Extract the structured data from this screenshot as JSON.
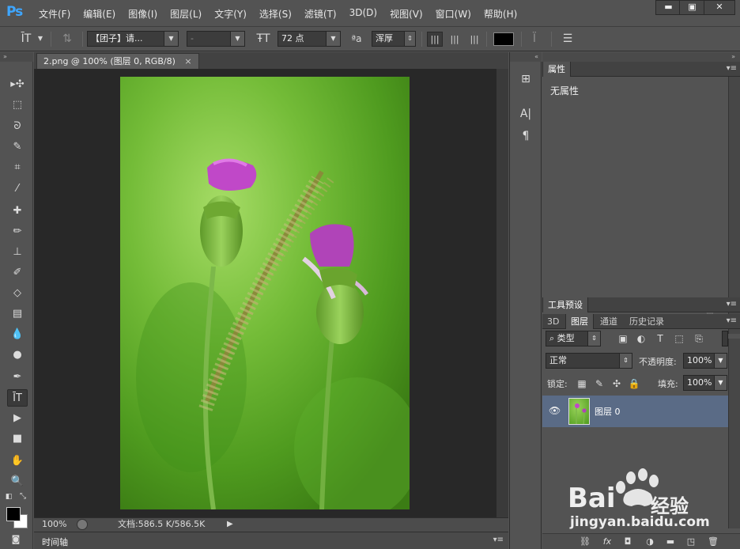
{
  "app": {
    "logo": "Ps"
  },
  "menu": [
    "文件(F)",
    "编辑(E)",
    "图像(I)",
    "图层(L)",
    "文字(Y)",
    "选择(S)",
    "滤镜(T)",
    "3D(D)",
    "视图(V)",
    "窗口(W)",
    "帮助(H)"
  ],
  "window_controls": {
    "minimize": "▬",
    "maximize": "▣",
    "close": "✕"
  },
  "options": {
    "tool_glyph": "ĪT",
    "font_family": "【团子】请...",
    "font_style": "-",
    "font_size": "72 点",
    "aa_glyph": "ªa",
    "antialias": "浑厚",
    "text_color": "#000000"
  },
  "document": {
    "tab_title": "2.png @ 100% (图层 0, RGB/8)",
    "tab_close": "×",
    "zoom": "100%",
    "doc_info": "文档:586.5 K/586.5K",
    "status_arrow": "▶"
  },
  "timeline": {
    "label": "时间轴"
  },
  "properties": {
    "tab": "属性",
    "empty_text": "无属性"
  },
  "tool_presets": {
    "tab": "工具预设"
  },
  "layers_panel": {
    "tabs": [
      "3D",
      "图层",
      "通道",
      "历史记录"
    ],
    "active_tab": "图层",
    "filter_kind": "类型",
    "blend_mode": "正常",
    "opacity_label": "不透明度:",
    "opacity_value": "100%",
    "lock_label": "锁定:",
    "fill_label": "填充:",
    "fill_value": "100%",
    "layers": [
      {
        "name": "图层 0",
        "visible": true,
        "selected": true
      }
    ]
  },
  "colors": {
    "foreground": "#000000",
    "background": "#ffffff",
    "selected_layer": "#5a6b86",
    "logo": "#3ea6ff"
  },
  "watermark": {
    "brand_left": "Bai",
    "brand_right": "经验",
    "url": "jingyan.baidu.com"
  }
}
